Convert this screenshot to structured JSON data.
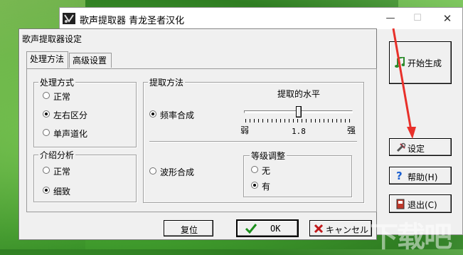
{
  "main_window": {
    "title": "歌声提取器 青龙圣者汉化",
    "min_glyph": "—",
    "max_glyph": "☐",
    "close_glyph": "✕",
    "buttons": {
      "start": "开始生成",
      "settings": "设定",
      "help": "帮助(H)",
      "exit": "退出(C)"
    }
  },
  "dialog": {
    "title": "歌声提取器设定",
    "tabs": [
      "处理方法",
      "高级设置"
    ],
    "processing": {
      "title": "处理方式",
      "options": [
        "正常",
        "左右区分",
        "单声道化"
      ],
      "selected": "左右区分"
    },
    "intro": {
      "title": "介绍分析",
      "options": [
        "正常",
        "细致"
      ],
      "selected": "细致"
    },
    "extract": {
      "title": "提取方法",
      "freq_label": "频率合成",
      "wave_label": "波形合成",
      "selected": "频率合成",
      "level_title": "提取的水平",
      "slider_min_label": "弱",
      "slider_max_label": "强",
      "slider_value": "1.8"
    },
    "grade": {
      "title": "等级调整",
      "options": [
        "无",
        "有"
      ],
      "selected": "有"
    },
    "buttons": {
      "reset": "复位",
      "ok": "OK",
      "cancel": "キャンセル"
    }
  },
  "watermark": "下载吧",
  "colors": {
    "arrow": "#e8302a",
    "window_bg": "#f0f0f0",
    "ok_check": "#1d8f1d",
    "cancel_x": "#c0181a"
  }
}
